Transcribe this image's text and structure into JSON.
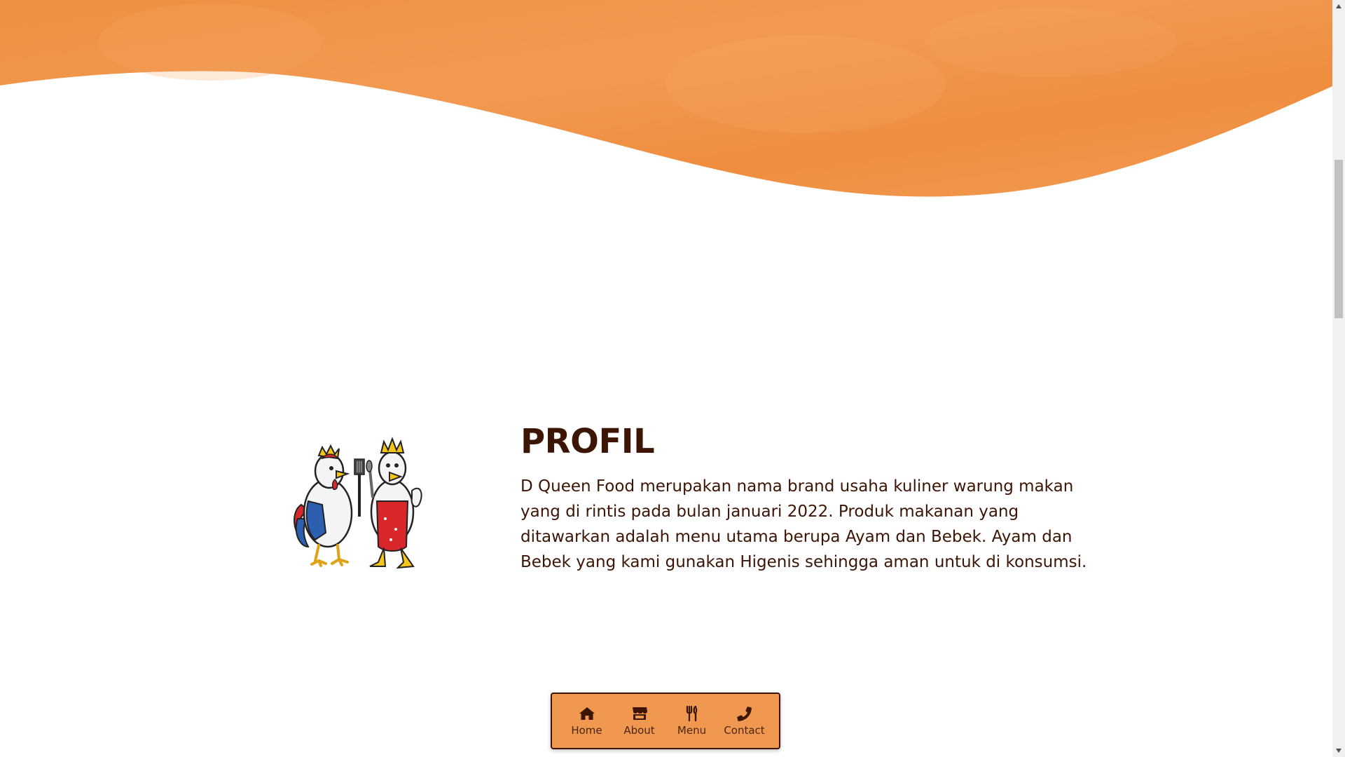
{
  "profile": {
    "title": "PROFIL",
    "description": "D Queen Food merupakan nama brand usaha kuliner warung makan yang di rintis pada bulan januari 2022. Produk makanan yang ditawarkan adalah menu utama berupa Ayam dan Bebek. Ayam dan Bebek yang kami gunakan Higenis sehingga aman untuk di konsumsi."
  },
  "nav": {
    "items": [
      {
        "label": "Home",
        "icon": "home-icon"
      },
      {
        "label": "About",
        "icon": "store-icon"
      },
      {
        "label": "Menu",
        "icon": "utensils-icon"
      },
      {
        "label": "Contact",
        "icon": "phone-icon"
      }
    ]
  },
  "colors": {
    "brand_orange": "#f0984f",
    "text_dark_brown": "#3d1505",
    "background": "#ffffff"
  }
}
